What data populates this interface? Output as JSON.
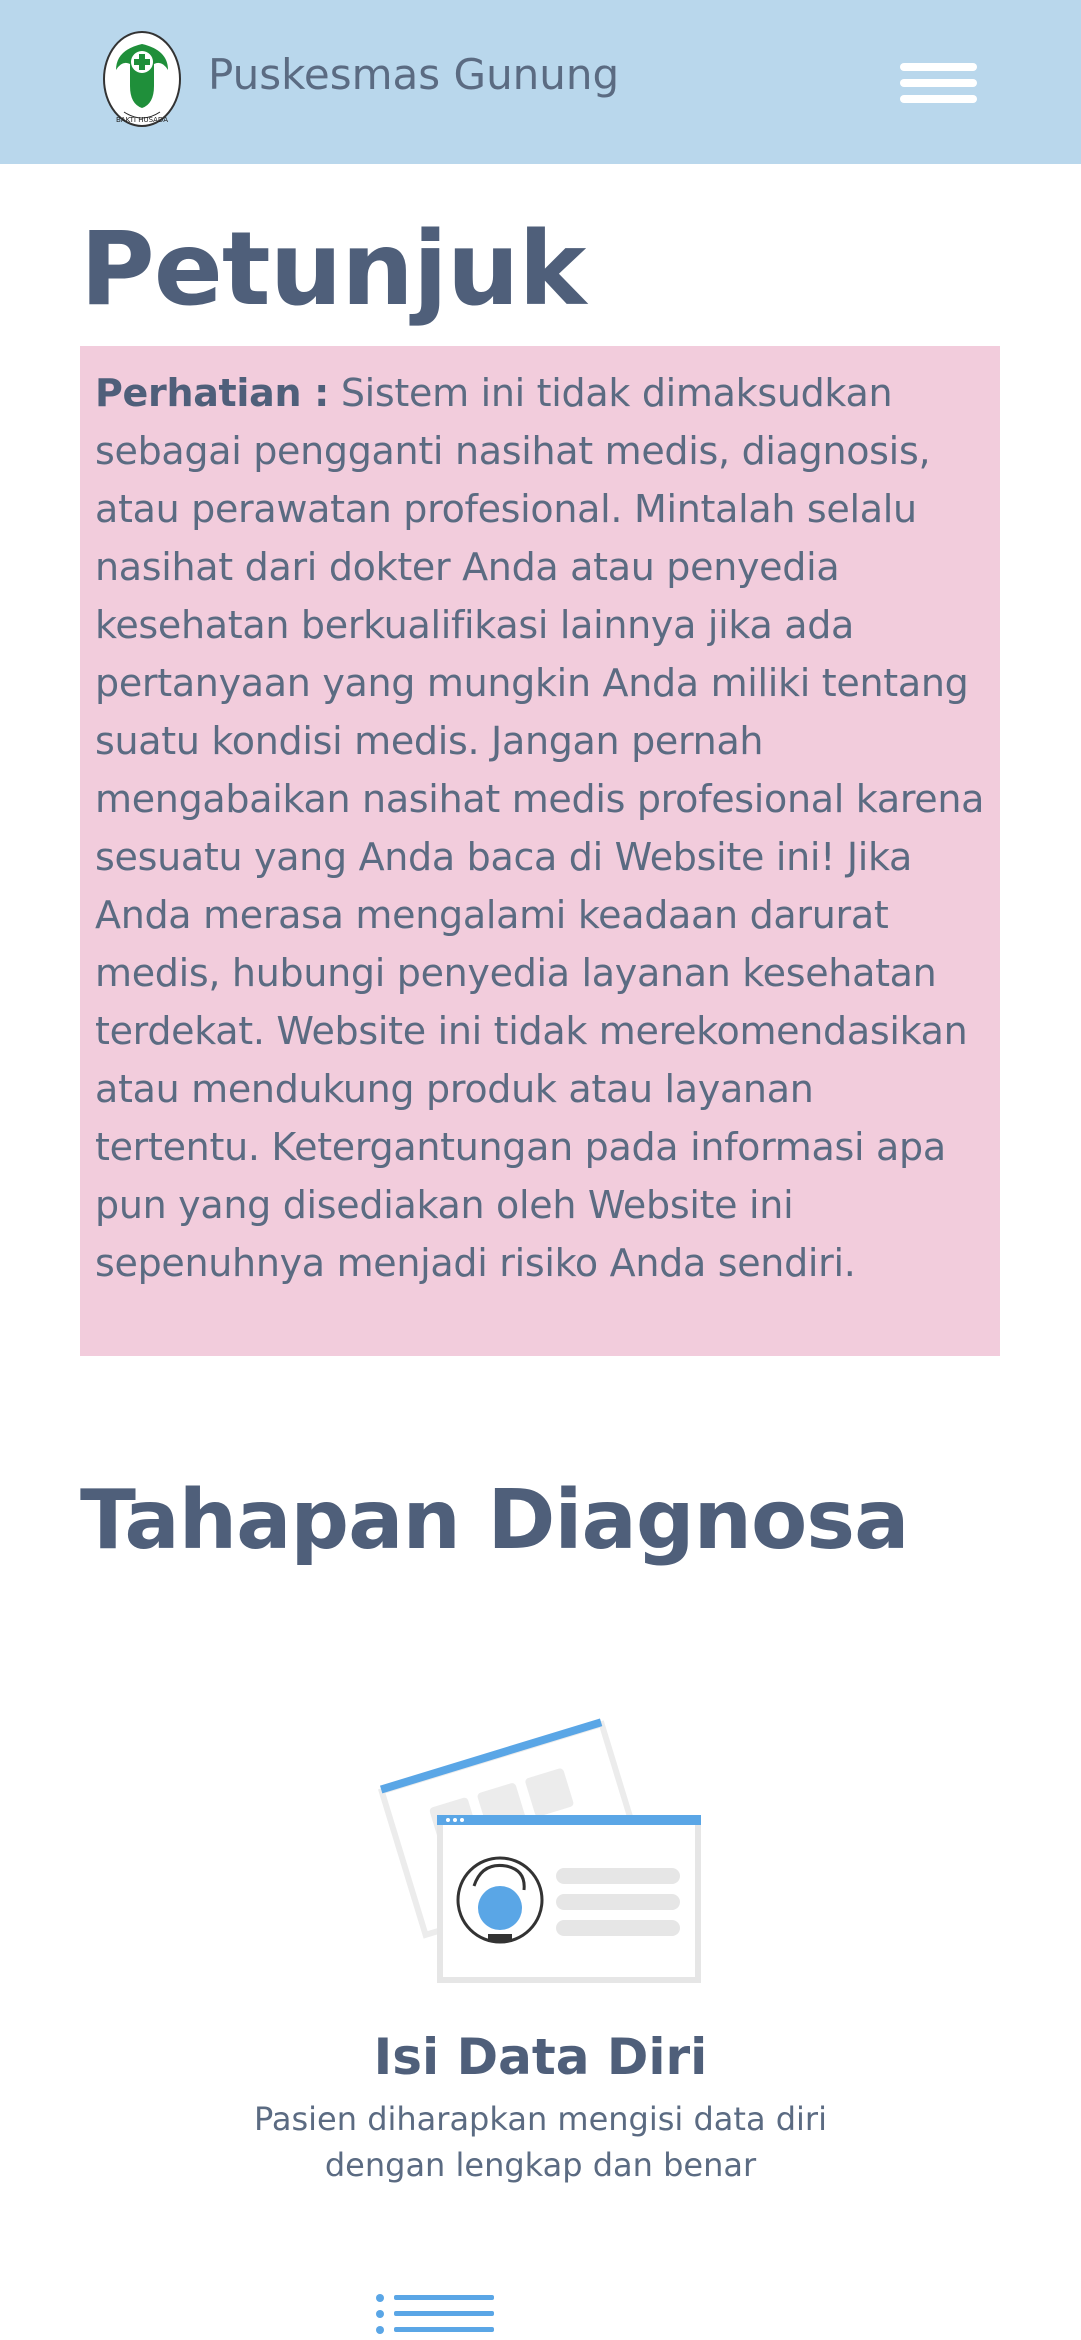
{
  "navbar": {
    "brand_name": "Puskesmas Gunung",
    "logo_text": "BAKTI HUSADA",
    "menu_icon": "hamburger-menu-icon"
  },
  "main": {
    "title": "Petunjuk",
    "notice": {
      "label": "Perhatian :",
      "text": " Sistem ini tidak dimaksudkan sebagai pengganti nasihat medis, diagnosis, atau perawatan profesional. Mintalah selalu nasihat dari dokter Anda atau penyedia kesehatan berkualifikasi lainnya jika ada pertanyaan yang mungkin Anda miliki tentang suatu kondisi medis. Jangan pernah mengabaikan nasihat medis profesional karena sesuatu yang Anda baca di Website ini! Jika Anda merasa mengalami keadaan darurat medis, hubungi penyedia layanan kesehatan terdekat. Website ini tidak merekomendasikan atau mendukung produk atau layanan tertentu. Ketergantungan pada informasi apa pun yang disediakan oleh Website ini sepenuhnya menjadi risiko Anda sendiri."
    }
  },
  "stages": {
    "title": "Tahapan Diagnosa",
    "steps": [
      {
        "icon": "profile-card-illustration",
        "title": "Isi Data Diri",
        "description": "Pasien diharapkan mengisi data diri dengan lengkap dan benar"
      }
    ]
  },
  "colors": {
    "navbar_bg": "#b9d7ec",
    "notice_bg": "#f2ccdc",
    "text": "#4f5f7a",
    "accent_blue": "#5aa6e6",
    "logo_green": "#1f8f3a"
  }
}
